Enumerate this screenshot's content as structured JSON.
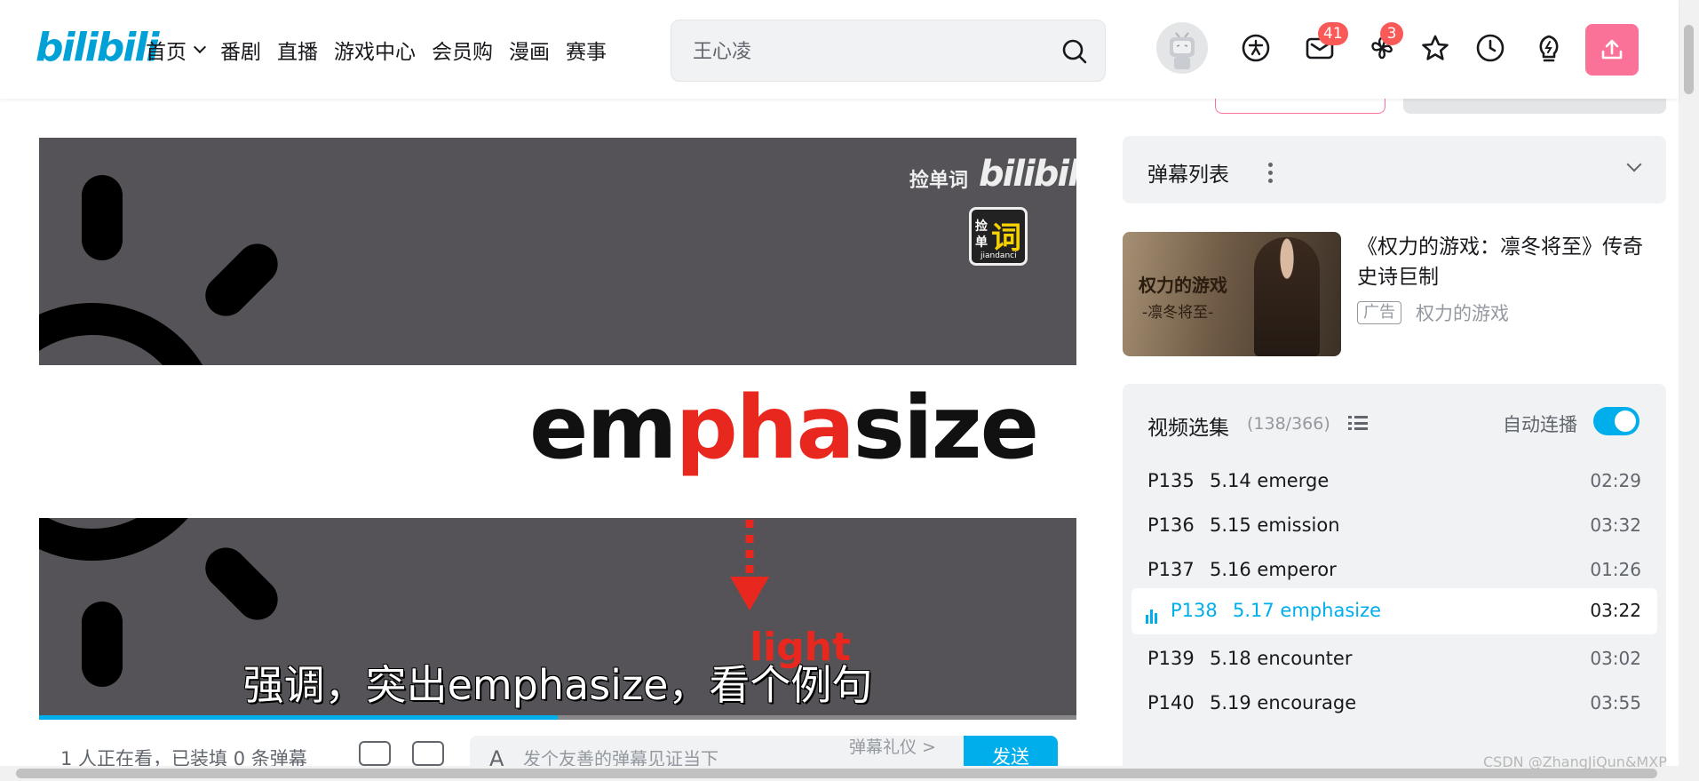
{
  "header": {
    "logo": "bilibili",
    "nav": [
      {
        "label": "首页",
        "has_dropdown": true
      },
      {
        "label": "番剧"
      },
      {
        "label": "直播"
      },
      {
        "label": "游戏中心"
      },
      {
        "label": "会员购"
      },
      {
        "label": "漫画"
      },
      {
        "label": "赛事"
      }
    ],
    "search_placeholder": "王心凌",
    "messages_badge": "41",
    "dynamic_badge": "3",
    "icons": [
      "big-member-icon",
      "message-icon",
      "dynamic-icon",
      "favorites-icon",
      "history-icon",
      "creation-icon",
      "upload-icon"
    ],
    "upload_color": "#fb7299"
  },
  "video": {
    "watermark_text": "捡单词",
    "watermark_logo": "bilibili",
    "watermark_box": {
      "c1": "捡",
      "c2": "单",
      "big": "词",
      "small": "jiandanci"
    },
    "word_pre": "em",
    "word_hl": "pha",
    "word_post": "size",
    "light_label": "light",
    "subtitle": "强调，突出emphasize，看个例句",
    "progress": 0.5,
    "highlight_color": "#e8281e"
  },
  "below_player": {
    "watching": "1 人正在看，已装填 0 条弹幕",
    "danmaku_placeholder": "发个友善的弹幕见证当下",
    "etiquette": "弹幕礼仪 >",
    "send": "发送"
  },
  "sidebar": {
    "danmaku_list_title": "弹幕列表",
    "ad": {
      "title": "《权力的游戏：凛冬将至》传奇史诗巨制",
      "tag": "广告",
      "source": "权力的游戏",
      "image_text1": "权力的游戏",
      "image_text2": "-凛冬将至-"
    },
    "series": {
      "title": "视频选集",
      "count": "(138/366)",
      "autoplay": "自动连播",
      "autoplay_on": true,
      "episodes": [
        {
          "p": "P135",
          "name": "5.14 emerge",
          "duration": "02:29",
          "active": false
        },
        {
          "p": "P136",
          "name": "5.15 emission",
          "duration": "03:32",
          "active": false
        },
        {
          "p": "P137",
          "name": "5.16 emperor",
          "duration": "01:26",
          "active": false
        },
        {
          "p": "P138",
          "name": "5.17 emphasize",
          "duration": "03:22",
          "active": true
        },
        {
          "p": "P139",
          "name": "5.18 encounter",
          "duration": "03:02",
          "active": false
        },
        {
          "p": "P140",
          "name": "5.19 encourage",
          "duration": "03:55",
          "active": false
        }
      ]
    }
  },
  "page_watermark": "CSDN @ZhangJiQun&MXP",
  "accent": "#00aeec"
}
